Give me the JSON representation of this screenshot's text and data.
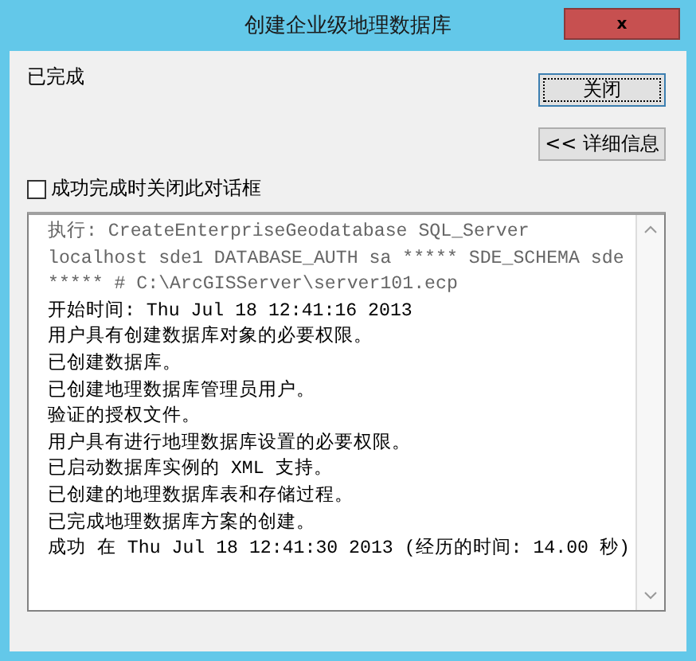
{
  "window": {
    "title": "创建企业级地理数据库",
    "close": "x"
  },
  "status": "已完成",
  "buttons": [
    {
      "label": "关闭",
      "focused": true
    },
    {
      "label": "<< 详细信息",
      "focused": false
    }
  ],
  "close_on_success": {
    "label": "成功完成时关闭此对话框",
    "checked": false
  },
  "log": [
    {
      "kind": "command",
      "text": "执行: CreateEnterpriseGeodatabase SQL_Server localhost sde1 DATABASE_AUTH sa ***** SDE_SCHEMA sde ***** # C:\\ArcGISServer\\server101.ecp"
    },
    {
      "kind": "message",
      "text": "开始时间: Thu Jul 18 12:41:16 2013"
    },
    {
      "kind": "message",
      "text": "用户具有创建数据库对象的必要权限。"
    },
    {
      "kind": "message",
      "text": "已创建数据库。"
    },
    {
      "kind": "message",
      "text": "已创建地理数据库管理员用户。"
    },
    {
      "kind": "message",
      "text": "验证的授权文件。"
    },
    {
      "kind": "message",
      "text": "用户具有进行地理数据库设置的必要权限。"
    },
    {
      "kind": "message",
      "text": "已启动数据库实例的 XML 支持。"
    },
    {
      "kind": "message",
      "text": "已创建的地理数据库表和存储过程。"
    },
    {
      "kind": "message",
      "text": "已完成地理数据库方案的创建。"
    },
    {
      "kind": "message",
      "text": "成功 在 Thu Jul 18 12:41:30 2013 (经历的时间: 14.00 秒)"
    }
  ]
}
